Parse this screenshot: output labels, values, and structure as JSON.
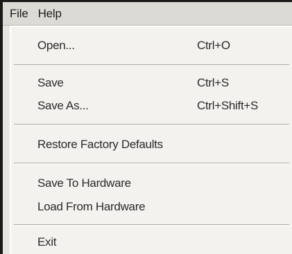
{
  "menubar": {
    "items": [
      {
        "label": "File"
      },
      {
        "label": "Help"
      }
    ]
  },
  "file_menu": {
    "open": {
      "label": "Open...",
      "shortcut": "Ctrl+O"
    },
    "save": {
      "label": "Save",
      "shortcut": "Ctrl+S"
    },
    "save_as": {
      "label": "Save As...",
      "shortcut": "Ctrl+Shift+S"
    },
    "restore": {
      "label": "Restore Factory Defaults"
    },
    "save_hw": {
      "label": "Save To Hardware"
    },
    "load_hw": {
      "label": "Load From Hardware"
    },
    "exit": {
      "label": "Exit"
    }
  }
}
